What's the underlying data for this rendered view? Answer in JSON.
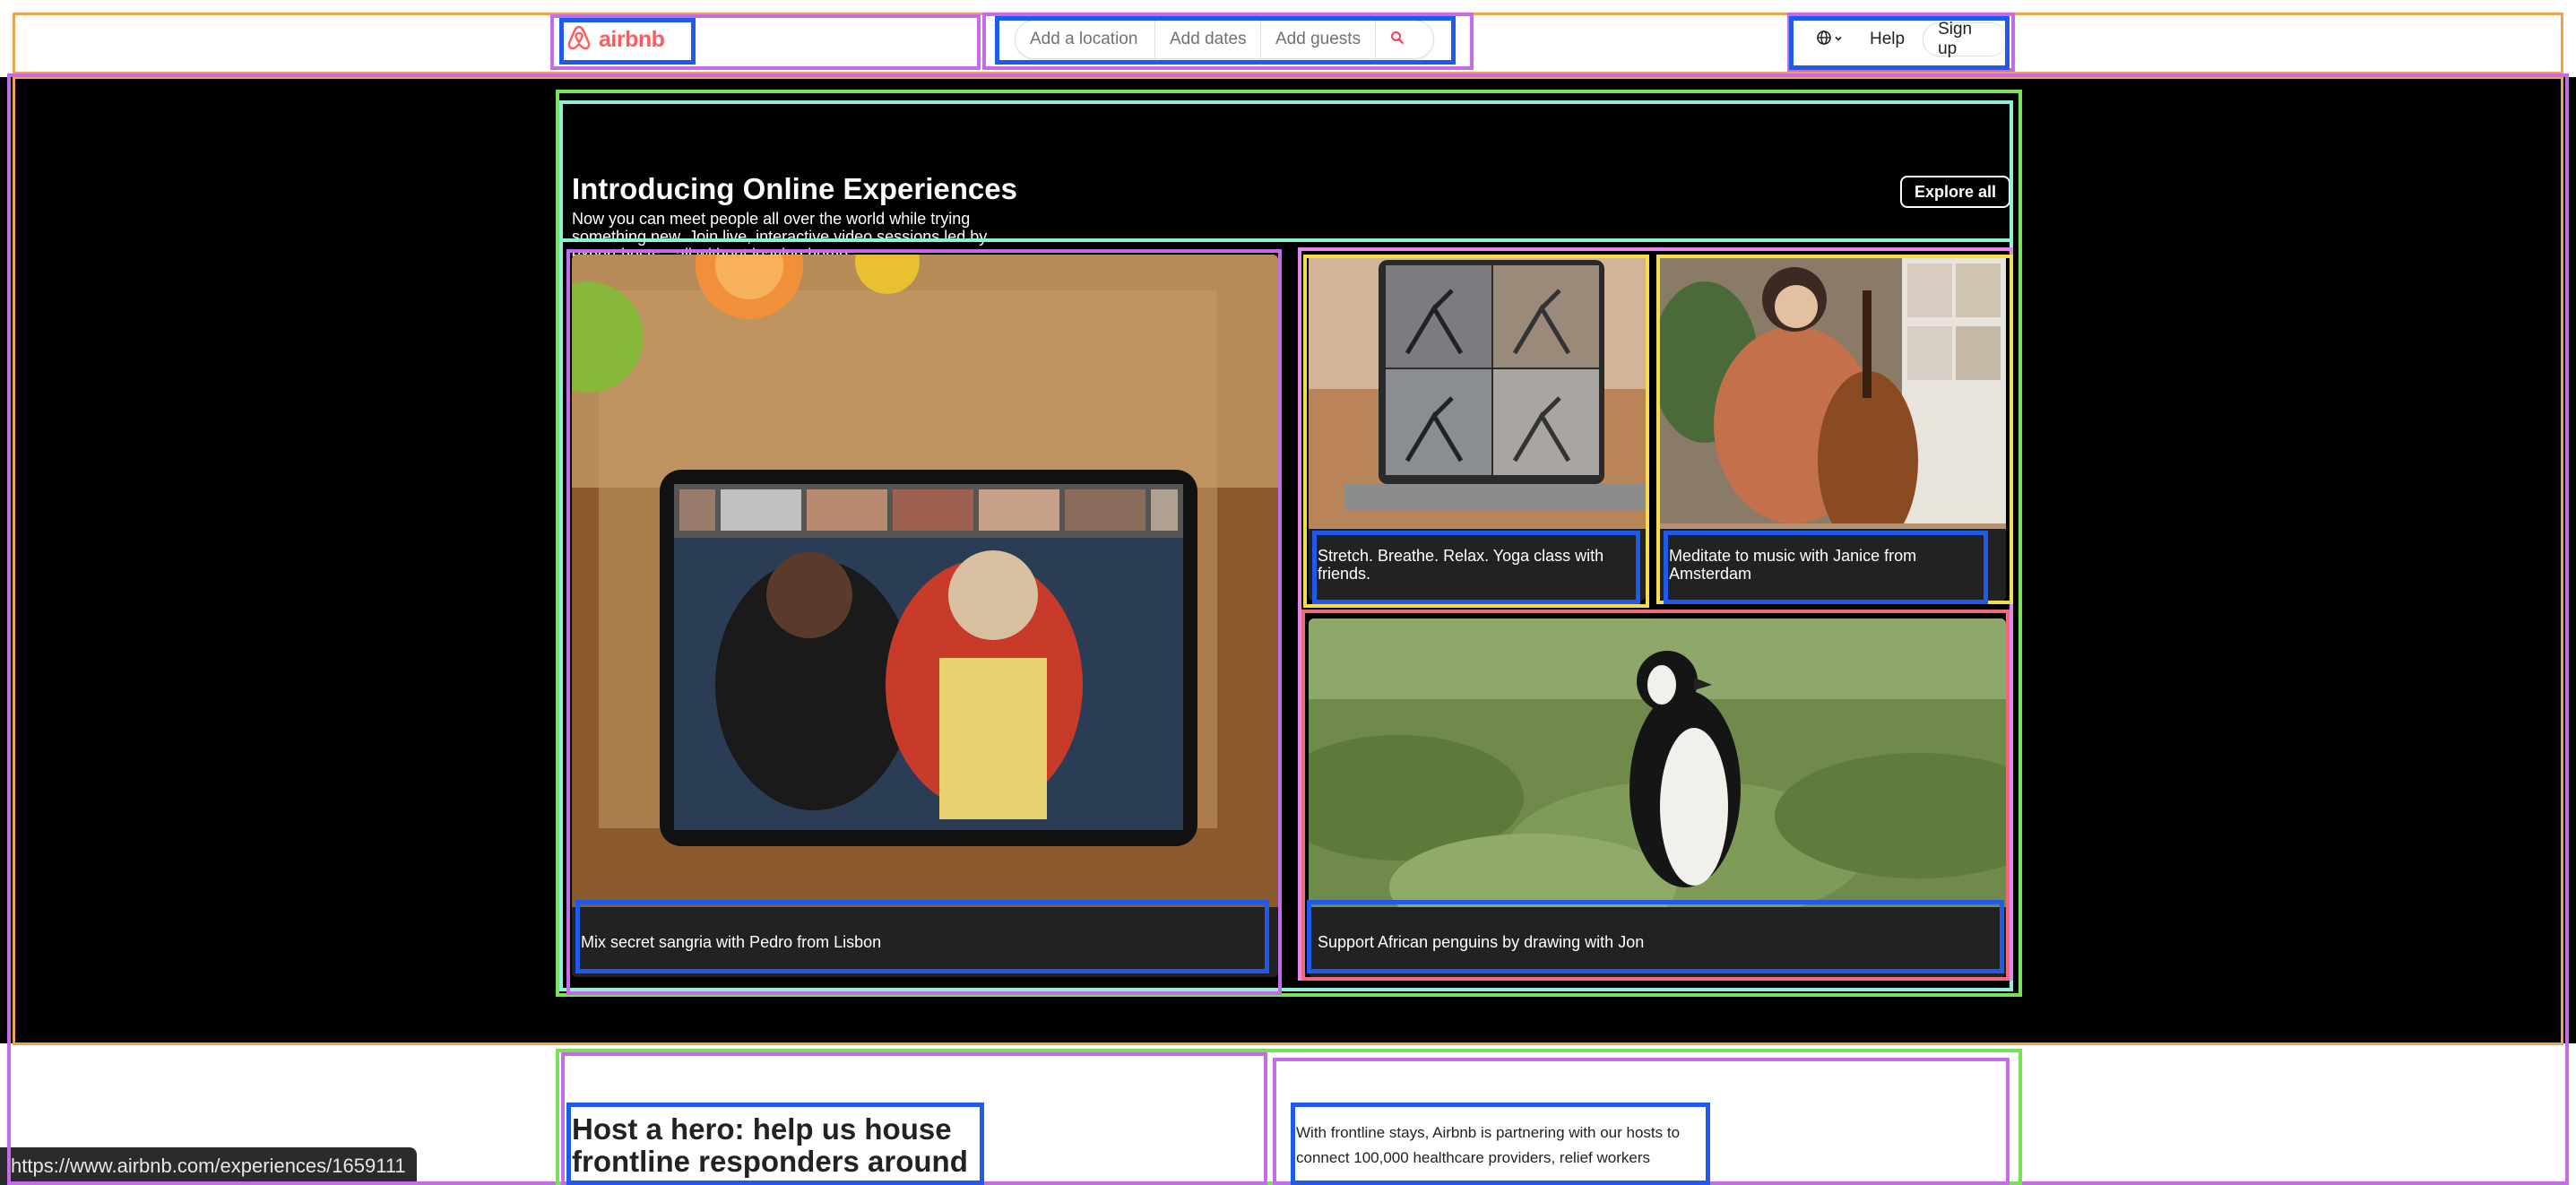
{
  "header": {
    "logo_text": "airbnb",
    "brand_color": "#ff5a5f",
    "search": {
      "location_placeholder": "Add a location",
      "dates_placeholder": "Add dates",
      "guests_placeholder": "Add guests",
      "button_icon": "search-icon"
    },
    "nav": {
      "language_icon": "globe-icon",
      "help_label": "Help",
      "signup_label": "Sign up"
    }
  },
  "hero": {
    "title": "Introducing Online Experiences",
    "description": "Now you can meet people all over the world while trying something new. Join live, interactive video sessions led by expert hosts—all without leaving home.",
    "explore_label": "Explore all",
    "cards": [
      {
        "caption": "Mix secret sangria with Pedro from Lisbon"
      },
      {
        "caption": "Stretch. Breathe. Relax. Yoga class with friends."
      },
      {
        "caption": "Meditate to music with Janice from Amsterdam"
      },
      {
        "caption": "Support African penguins by drawing with Jon"
      }
    ]
  },
  "lower": {
    "title": "Host a hero: help us house frontline responders around",
    "text": "With frontline stays, Airbnb is partnering with our hosts to connect 100,000 healthcare providers, relief workers"
  },
  "status_bar": {
    "url": "https://www.airbnb.com/experiences/1659111"
  }
}
